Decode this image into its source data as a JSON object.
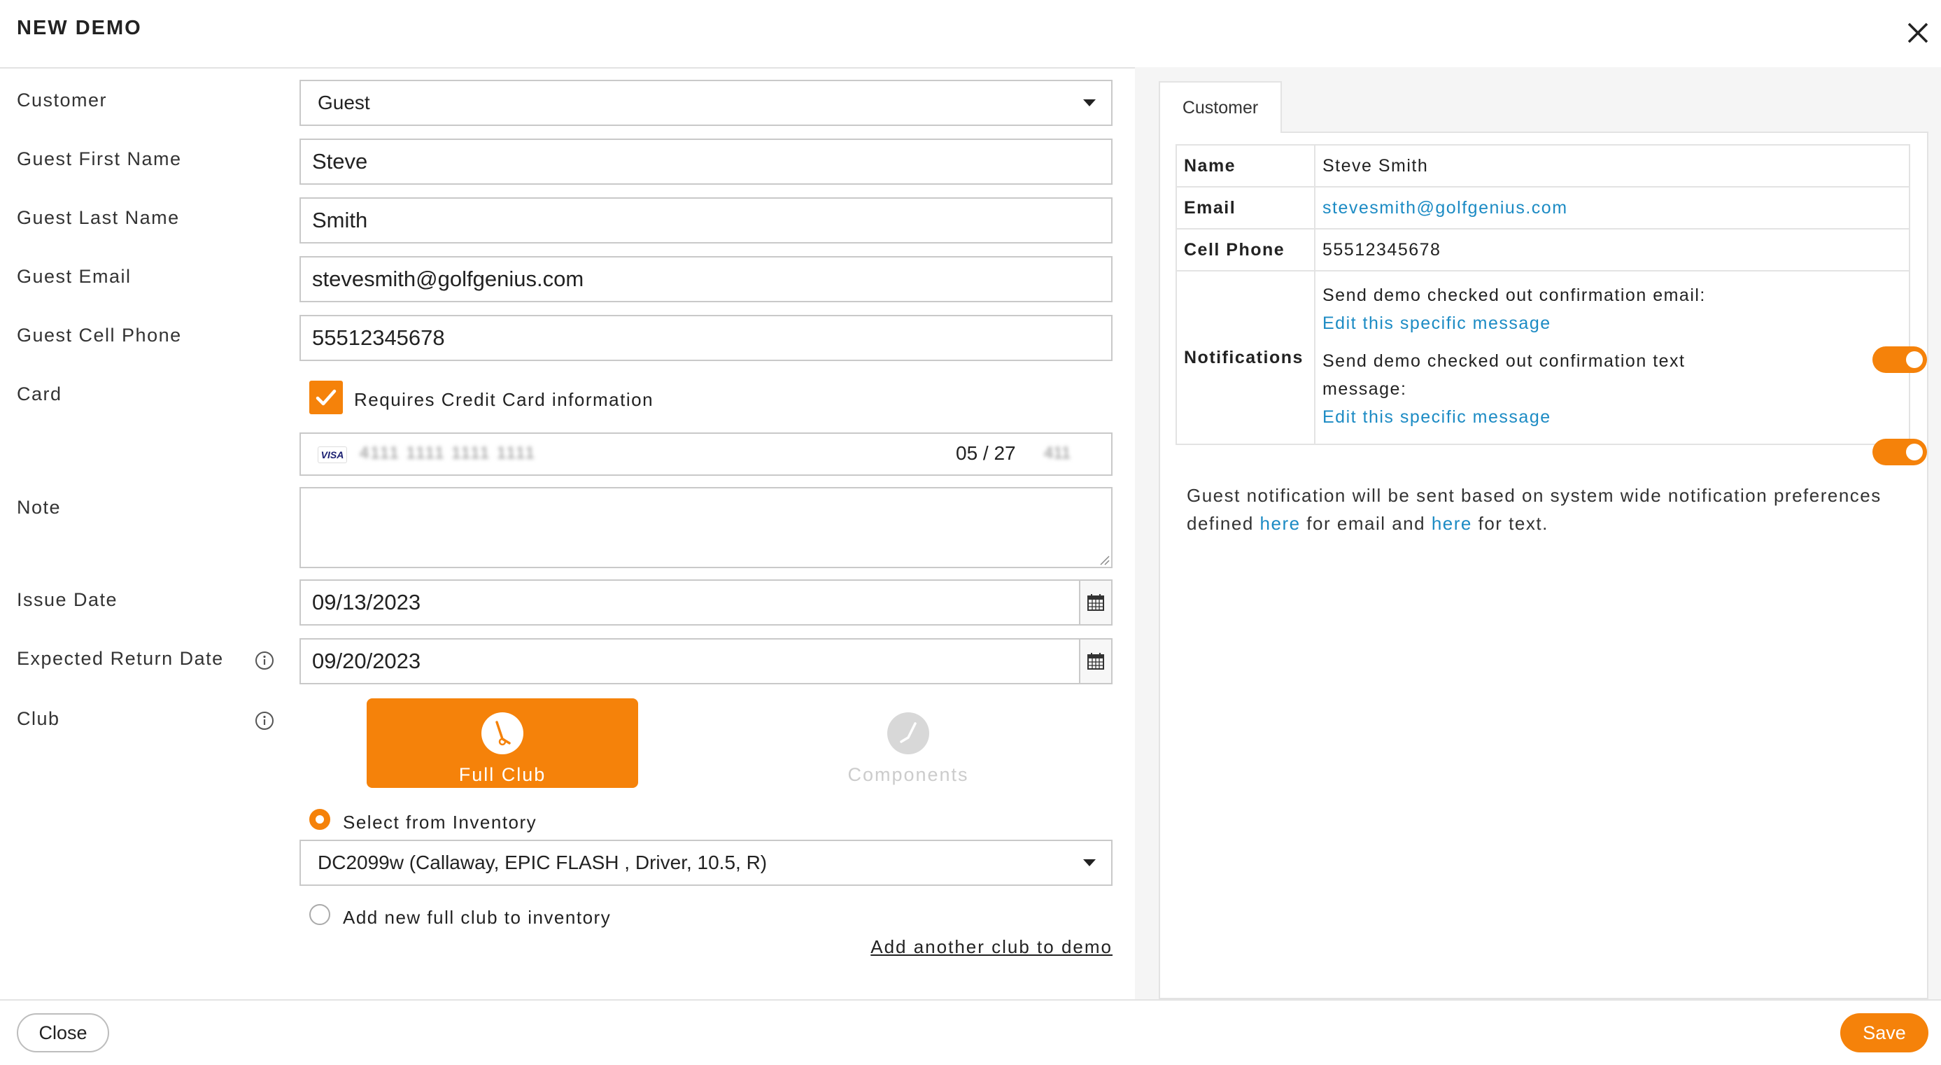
{
  "header": {
    "title": "NEW DEMO"
  },
  "form": {
    "customer_label": "Customer",
    "customer_value": "Guest",
    "first_name_label": "Guest First Name",
    "first_name_value": "Steve",
    "last_name_label": "Guest Last Name",
    "last_name_value": "Smith",
    "email_label": "Guest Email",
    "email_value": "stevesmith@golfgenius.com",
    "phone_label": "Guest Cell Phone",
    "phone_value": "55512345678",
    "card_label": "Card",
    "card_checkbox_label": "Requires Credit Card information",
    "card_checked": true,
    "card_brand": "VISA",
    "card_number": "4111 1111 1111 1111",
    "card_expiry": "05 / 27",
    "card_cvc": "411",
    "note_label": "Note",
    "note_value": "",
    "issue_date_label": "Issue Date",
    "issue_date_value": "09/13/2023",
    "return_date_label": "Expected Return Date",
    "return_date_value": "09/20/2023",
    "club_label": "Club",
    "club_tiles": [
      {
        "label": "Full Club",
        "selected": true
      },
      {
        "label": "Components",
        "selected": false
      }
    ],
    "select_inventory_label": "Select from Inventory",
    "inventory_value": "DC2099w (Callaway, EPIC FLASH , Driver, 10.5, R)",
    "add_new_label": "Add new full club to inventory",
    "add_another_link": "Add another club to demo"
  },
  "footer": {
    "close_label": "Close",
    "save_label": "Save"
  },
  "customer_panel": {
    "tab_label": "Customer",
    "rows": {
      "name_key": "Name",
      "name_value": "Steve Smith",
      "email_key": "Email",
      "email_value": "stevesmith@golfgenius.com",
      "phone_key": "Cell Phone",
      "phone_value": "55512345678",
      "notifications_key": "Notifications"
    },
    "notifications": [
      {
        "text": "Send demo checked out confirmation email:",
        "link": "Edit this specific message",
        "enabled": true
      },
      {
        "text": "Send demo checked out confirmation text message:",
        "link": "Edit this specific message",
        "enabled": true
      }
    ],
    "guest_note_pre": "Guest notification will be sent based on system wide notification preferences defined ",
    "guest_note_link1": "here",
    "guest_note_mid": " for email and ",
    "guest_note_link2": "here",
    "guest_note_post": " for text."
  },
  "colors": {
    "accent": "#f5820a",
    "link": "#1c8bc4",
    "border": "#c9c9c9"
  }
}
